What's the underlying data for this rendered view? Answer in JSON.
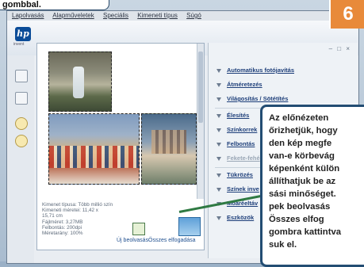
{
  "top_caption": "gombbal.",
  "badge_number": "6",
  "menu": [
    "Lapolvasás",
    "Alapműveletek",
    "Speciális",
    "Kimeneti típus",
    "Súgó"
  ],
  "logo": {
    "text": "hp",
    "sub": "invent"
  },
  "window_controls": "– □ ×",
  "options": [
    {
      "label": "Automatikus fotójavítás",
      "enabled": true
    },
    {
      "label": "Átméretezés",
      "enabled": true
    },
    {
      "label": "Világosítás / Sötétítés",
      "enabled": true
    },
    {
      "label": "Élesítés",
      "enabled": true
    },
    {
      "label": "Színkorrek",
      "enabled": true
    },
    {
      "label": "Felbontás",
      "enabled": true
    },
    {
      "label": "Fekete-fehé",
      "enabled": false
    },
    {
      "label": "Tükrözés",
      "enabled": true
    },
    {
      "label": "Színek inve",
      "enabled": true
    },
    {
      "label": "Moaréeltáv",
      "enabled": true
    },
    {
      "label": "Eszközök",
      "enabled": true
    }
  ],
  "info": [
    "Kimenet típusa: Több millió szín",
    "Kimeneti méretei: 11,42 x",
    "15,71 cm",
    "Fájlméret: 3,27MB",
    "Felbontás: 200dpi",
    "Méretarány: 100%"
  ],
  "buttons": {
    "new_scan": "Új beolvasás",
    "accept_all": "Összes elfogadása"
  },
  "callout_lines": [
    "Az előnézeten",
    "őrizhetjük, hogy",
    "den kép megfe",
    "van-e körbevág",
    "képenként külön",
    "állíthatjuk be az",
    "sási minőséget.",
    "pek beolvasás",
    "Összes    elfog",
    "gombra kattintva",
    "suk el."
  ]
}
